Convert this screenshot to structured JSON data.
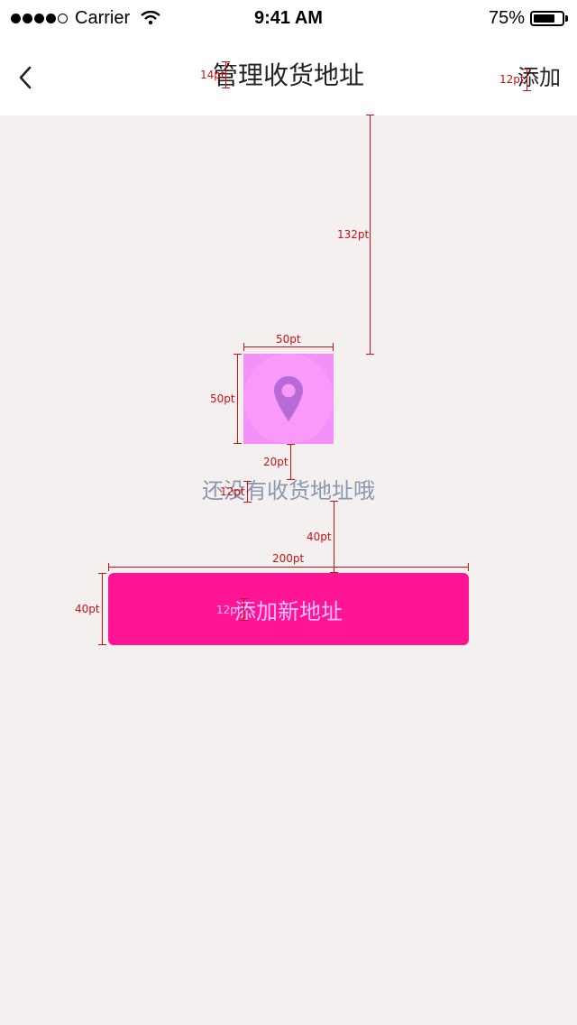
{
  "status_bar": {
    "carrier": "Carrier",
    "time": "9:41 AM",
    "battery_percent": "75%",
    "battery_level": 0.75
  },
  "nav": {
    "title": "管理收货地址",
    "add_label": "添加"
  },
  "empty_state": {
    "message": "还没有收货地址哦",
    "icon": "location-pin-icon"
  },
  "add_button": {
    "label": "添加新地址"
  },
  "annotations": {
    "title_font": "14pt",
    "add_font": "12pt",
    "gap_top": "132pt",
    "icon_width": "50pt",
    "icon_height": "50pt",
    "gap_icon_text": "20pt",
    "text_font": "12pt",
    "gap_text_button": "40pt",
    "button_width": "200pt",
    "button_height": "40pt",
    "button_font": "12pt"
  },
  "colors": {
    "accent": "#ff1593",
    "icon_bg": "#f590f8",
    "icon_pin": "#b86bd6",
    "empty_text": "#8a98b0",
    "annotation": "#cc1111"
  }
}
